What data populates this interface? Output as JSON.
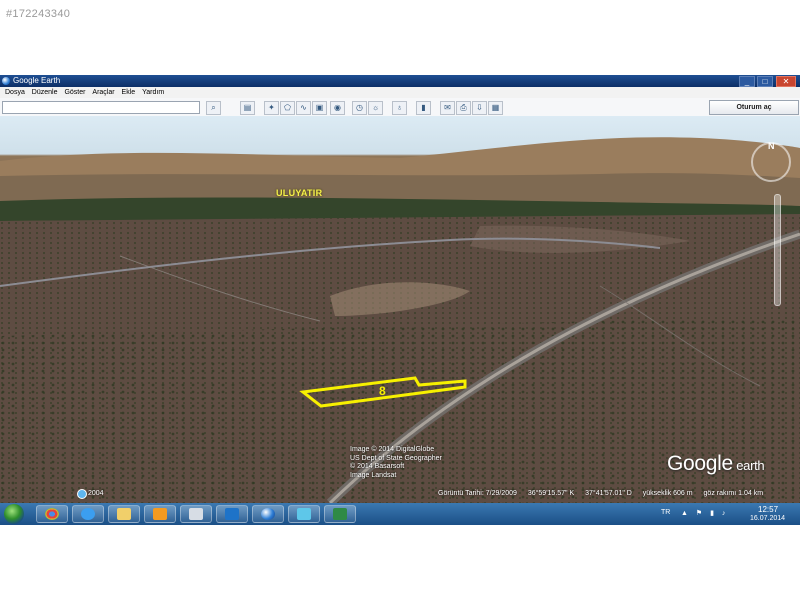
{
  "listing_id": "#172243340",
  "window": {
    "title": "Google Earth",
    "controls": {
      "minimize": "_",
      "maximize": "□",
      "close": "✕"
    }
  },
  "menu": {
    "items": [
      "Dosya",
      "Düzenle",
      "Göster",
      "Araçlar",
      "Ekle",
      "Yardım"
    ]
  },
  "toolbar": {
    "search_placeholder": "",
    "signin_label": "Oturum aç",
    "tools": [
      "sidebar-icon",
      "placemark-icon",
      "polygon-icon",
      "path-icon",
      "overlay-icon",
      "tour-icon",
      "history-icon",
      "sun-icon",
      "planets-icon",
      "ruler-icon",
      "email-icon",
      "print-icon",
      "save-image-icon"
    ]
  },
  "map": {
    "town_label": "ULUYATIR",
    "parcel_label": "8",
    "attribution": [
      "Image © 2014 DigitalGlobe",
      "US Dept of State Geographer",
      "© 2014 Basarsoft",
      "Image Landsat"
    ],
    "logo_text": "Google",
    "logo_suffix": " earth",
    "compass_label": "N",
    "year": "2004",
    "parcel_color": "#f7f000"
  },
  "status": {
    "imagery_date": "Görüntü Tarihi: 7/29/2009",
    "lat": "36°59'15.57\" K",
    "lon": "37°41'57.01\" D",
    "elevation": "yükseklik   606 m",
    "eye_alt": "göz rakımı   1.04 km"
  },
  "taskbar": {
    "apps": [
      "chrome-icon",
      "ie-icon",
      "explorer-icon",
      "media-player-icon",
      "calculator-icon",
      "teamviewer-icon",
      "google-earth-icon",
      "paint-icon",
      "excel-icon"
    ],
    "tray_lang": "TR",
    "tray_icons": "▲ ⚑ ▮ ♪",
    "time": "12:57",
    "date": "16.07.2014"
  }
}
